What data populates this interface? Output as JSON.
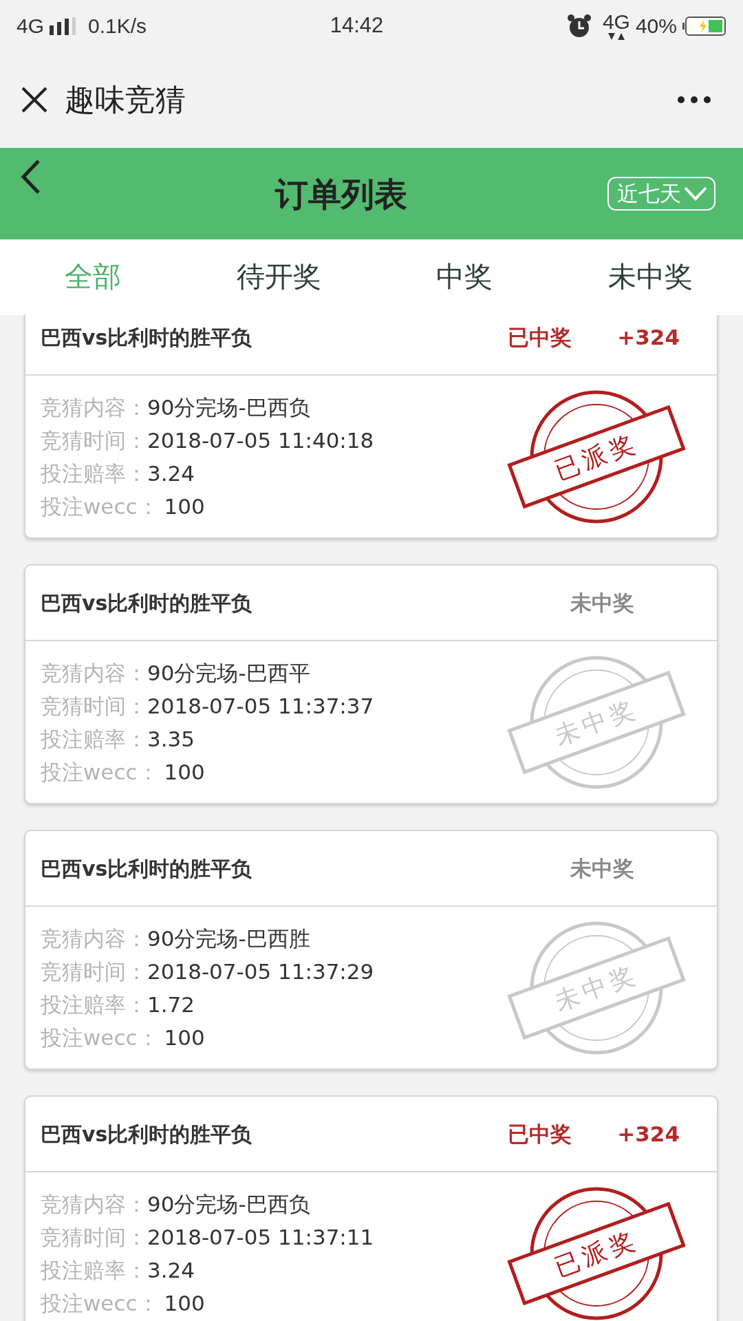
{
  "status_bar": {
    "network": "4G",
    "speed": "0.1K/s",
    "time": "14:42",
    "network_2": "4G",
    "battery": "40%"
  },
  "title_bar": {
    "title": "趣味竞猜"
  },
  "header": {
    "title": "订单列表",
    "filter": "近七天"
  },
  "tabs": [
    {
      "label": "全部",
      "selected": true
    },
    {
      "label": "待开奖",
      "selected": false
    },
    {
      "label": "中奖",
      "selected": false
    },
    {
      "label": "未中奖",
      "selected": false
    }
  ],
  "orders": [
    {
      "title": "巴西vs比利时的胜平负",
      "kind": "won",
      "status": "已中奖",
      "payout": "+324",
      "stamp": "已派奖",
      "fields": [
        {
          "label": "竞猜内容：",
          "value": "90分完场-巴西负"
        },
        {
          "label": "竞猜时间：",
          "value": "2018-07-05 11:40:18"
        },
        {
          "label": "投注赔率：",
          "value": "3.24"
        },
        {
          "label": "投注wecc：",
          "value": "100"
        }
      ]
    },
    {
      "title": "巴西vs比利时的胜平负",
      "kind": "lost",
      "status": "未中奖",
      "stamp": "未中奖",
      "fields": [
        {
          "label": "竞猜内容：",
          "value": "90分完场-巴西平"
        },
        {
          "label": "竞猜时间：",
          "value": "2018-07-05 11:37:37"
        },
        {
          "label": "投注赔率：",
          "value": "3.35"
        },
        {
          "label": "投注wecc：",
          "value": "100"
        }
      ]
    },
    {
      "title": "巴西vs比利时的胜平负",
      "kind": "lost",
      "status": "未中奖",
      "stamp": "未中奖",
      "fields": [
        {
          "label": "竞猜内容：",
          "value": "90分完场-巴西胜"
        },
        {
          "label": "竞猜时间：",
          "value": "2018-07-05 11:37:29"
        },
        {
          "label": "投注赔率：",
          "value": "1.72"
        },
        {
          "label": "投注wecc：",
          "value": "100"
        }
      ]
    },
    {
      "title": "巴西vs比利时的胜平负",
      "kind": "won",
      "status": "已中奖",
      "payout": "+324",
      "stamp": "已派奖",
      "fields": [
        {
          "label": "竞猜内容：",
          "value": "90分完场-巴西负"
        },
        {
          "label": "竞猜时间：",
          "value": "2018-07-05 11:37:11"
        },
        {
          "label": "投注赔率：",
          "value": "3.24"
        },
        {
          "label": "投注wecc：",
          "value": "100"
        }
      ]
    }
  ]
}
